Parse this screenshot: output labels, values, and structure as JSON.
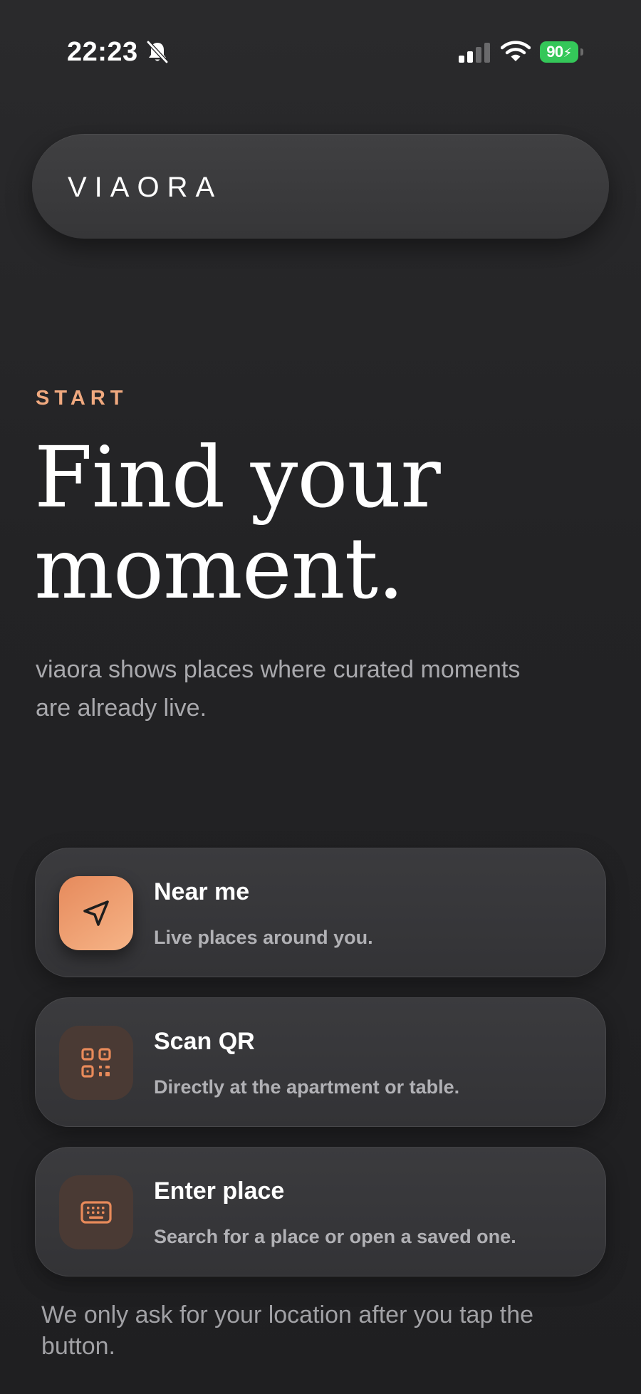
{
  "status_bar": {
    "time": "22:23",
    "battery_level": "90",
    "icons": [
      "bell-slash-icon",
      "cellular-signal-icon",
      "wifi-icon",
      "battery-charging-icon"
    ]
  },
  "brand": {
    "logo_text": "VIAORA"
  },
  "hero": {
    "eyebrow": "START",
    "headline_line1": "Find your",
    "headline_line2": "moment.",
    "subtitle": "viaora shows places where curated moments are already live."
  },
  "options": [
    {
      "title": "Near me",
      "description": "Live places around you.",
      "icon": "navigation-arrow-icon"
    },
    {
      "title": "Scan QR",
      "description": "Directly at the apartment or table.",
      "icon": "qr-code-icon"
    },
    {
      "title": "Enter place",
      "description": "Search for a place or open a saved one.",
      "icon": "keyboard-icon"
    }
  ],
  "footnote": "We only ask for your location after you tap the button.",
  "colors": {
    "accent": "#f0a97f",
    "accent_gradient_start": "#e68a5c",
    "accent_gradient_end": "#f6b487",
    "background": "#232325",
    "card": "#38383b",
    "battery": "#34c759"
  }
}
